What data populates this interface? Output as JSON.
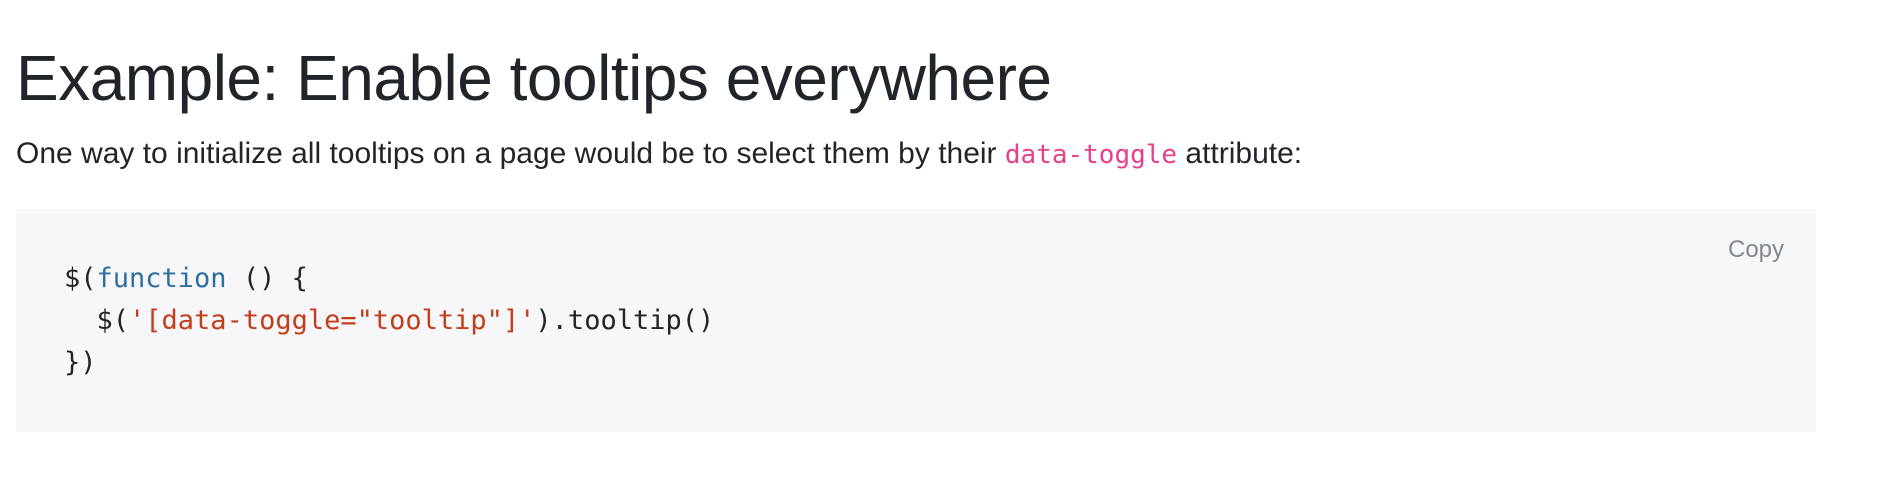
{
  "heading": "Example: Enable tooltips everywhere",
  "intro": {
    "before": "One way to initialize all tooltips on a page would be to select them by their ",
    "code": "data-toggle",
    "after": " attribute:"
  },
  "code_block": {
    "copy_label": "Copy",
    "line1": {
      "a": "$(",
      "keyword": "function",
      "b": " () {"
    },
    "line2": {
      "a": "  $(",
      "string": "'[data-toggle=\"tooltip\"]'",
      "b": ").tooltip()"
    },
    "line3": "})"
  },
  "colors": {
    "inline_code": "#e83e8c",
    "keyword": "#2f6f9f",
    "string": "#c33d1a",
    "code_background": "#f7f7f9"
  }
}
